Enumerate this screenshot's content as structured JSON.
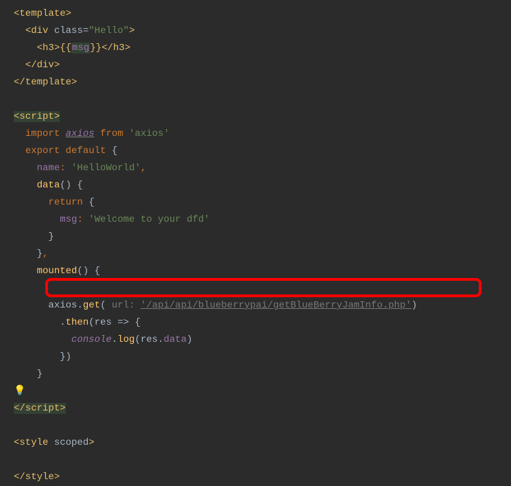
{
  "lines": {
    "l1_tag": "template",
    "l2_tag": "div",
    "l2_attr": "class",
    "l2_val": "\"Hello\"",
    "l3_tag": "h3",
    "l3_var": "msg",
    "l4_tag": "/div",
    "l5_tag": "/template",
    "l7_tag": "script",
    "l8_import": "import",
    "l8_axios": "axios",
    "l8_from": "from",
    "l8_str": "'axios'",
    "l9_export": "export",
    "l9_default": "default",
    "l10_name": "name",
    "l10_val": "'HelloWorld'",
    "l11_data": "data",
    "l12_return": "return",
    "l13_msg": "msg",
    "l13_val": "'Welcome to your dfd'",
    "l16_mounted": "mounted",
    "l17_axios": "axios",
    "l17_get": "get",
    "l17_hint_label": "url:",
    "l17_url": "'/api/api/blueberrypai/getBlueBerryJamInfo.php'",
    "l18_then": "then",
    "l18_res": "res",
    "l19_console": "console",
    "l19_log": "log",
    "l19_arg": "res",
    "l19_data": "data",
    "l23_tag": "/script",
    "l25_tag": "style",
    "l25_attr": "scoped",
    "l27_tag": "/style"
  },
  "icons": {
    "bulb": "💡"
  }
}
